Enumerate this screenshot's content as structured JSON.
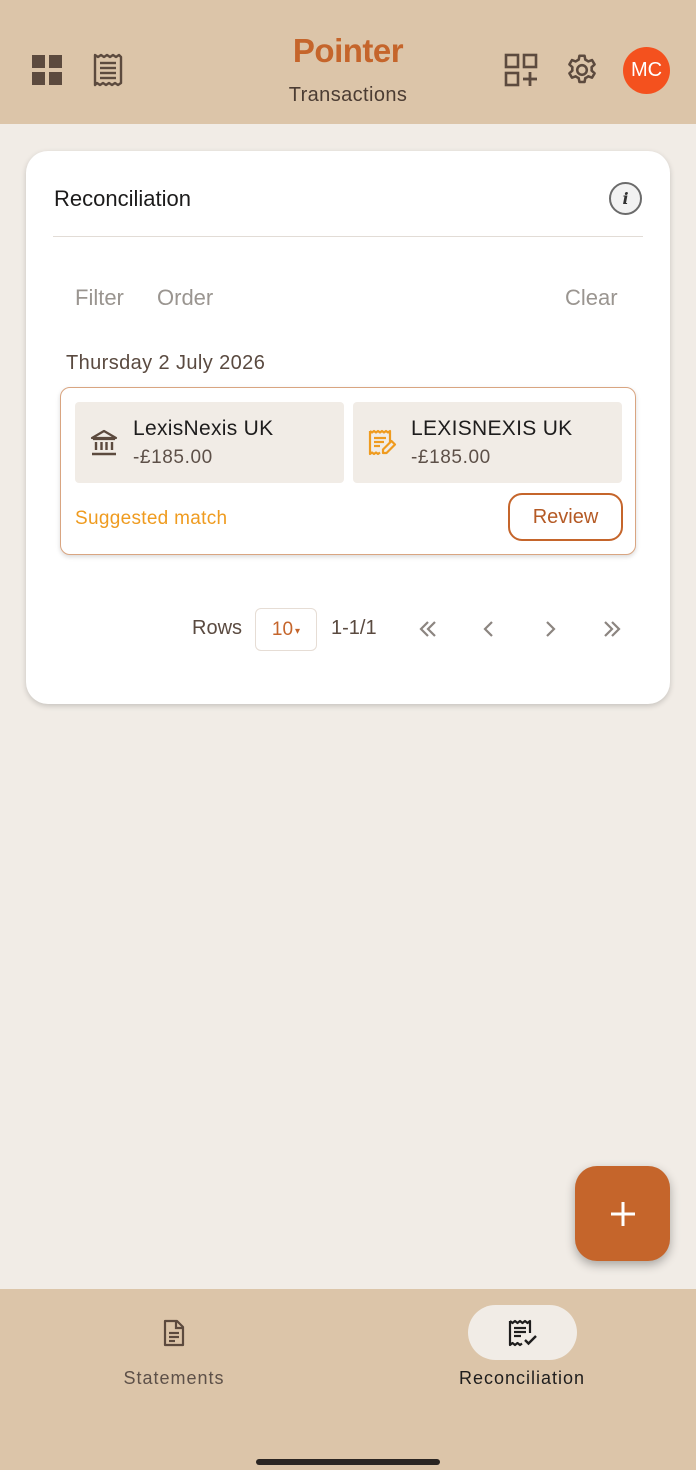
{
  "header": {
    "brand": "Pointer",
    "subtitle": "Transactions",
    "avatar_initials": "MC"
  },
  "card": {
    "title": "Reconciliation",
    "filter_label": "Filter",
    "order_label": "Order",
    "clear_label": "Clear",
    "date_heading": "Thursday 2 July 2026",
    "match": {
      "bank": {
        "name": "LexisNexis UK",
        "amount": "-£185.00",
        "icon": "bank-icon"
      },
      "ledger": {
        "name": "LEXISNEXIS UK",
        "amount": "-£185.00",
        "icon": "receipt-edit-icon"
      },
      "status": "Suggested match",
      "review_label": "Review"
    },
    "pager": {
      "rows_label": "Rows",
      "rows_value": "10",
      "range": "1-1/1"
    }
  },
  "bottom_nav": {
    "items": [
      {
        "label": "Statements",
        "icon": "document-icon",
        "active": false
      },
      {
        "label": "Reconciliation",
        "icon": "receipt-check-icon",
        "active": true
      }
    ]
  },
  "colors": {
    "brand": "#c5652b",
    "header_bg": "#dcc5a9",
    "page_bg": "#f1ece6",
    "suggested": "#ef9b1f",
    "avatar": "#f4511e"
  }
}
